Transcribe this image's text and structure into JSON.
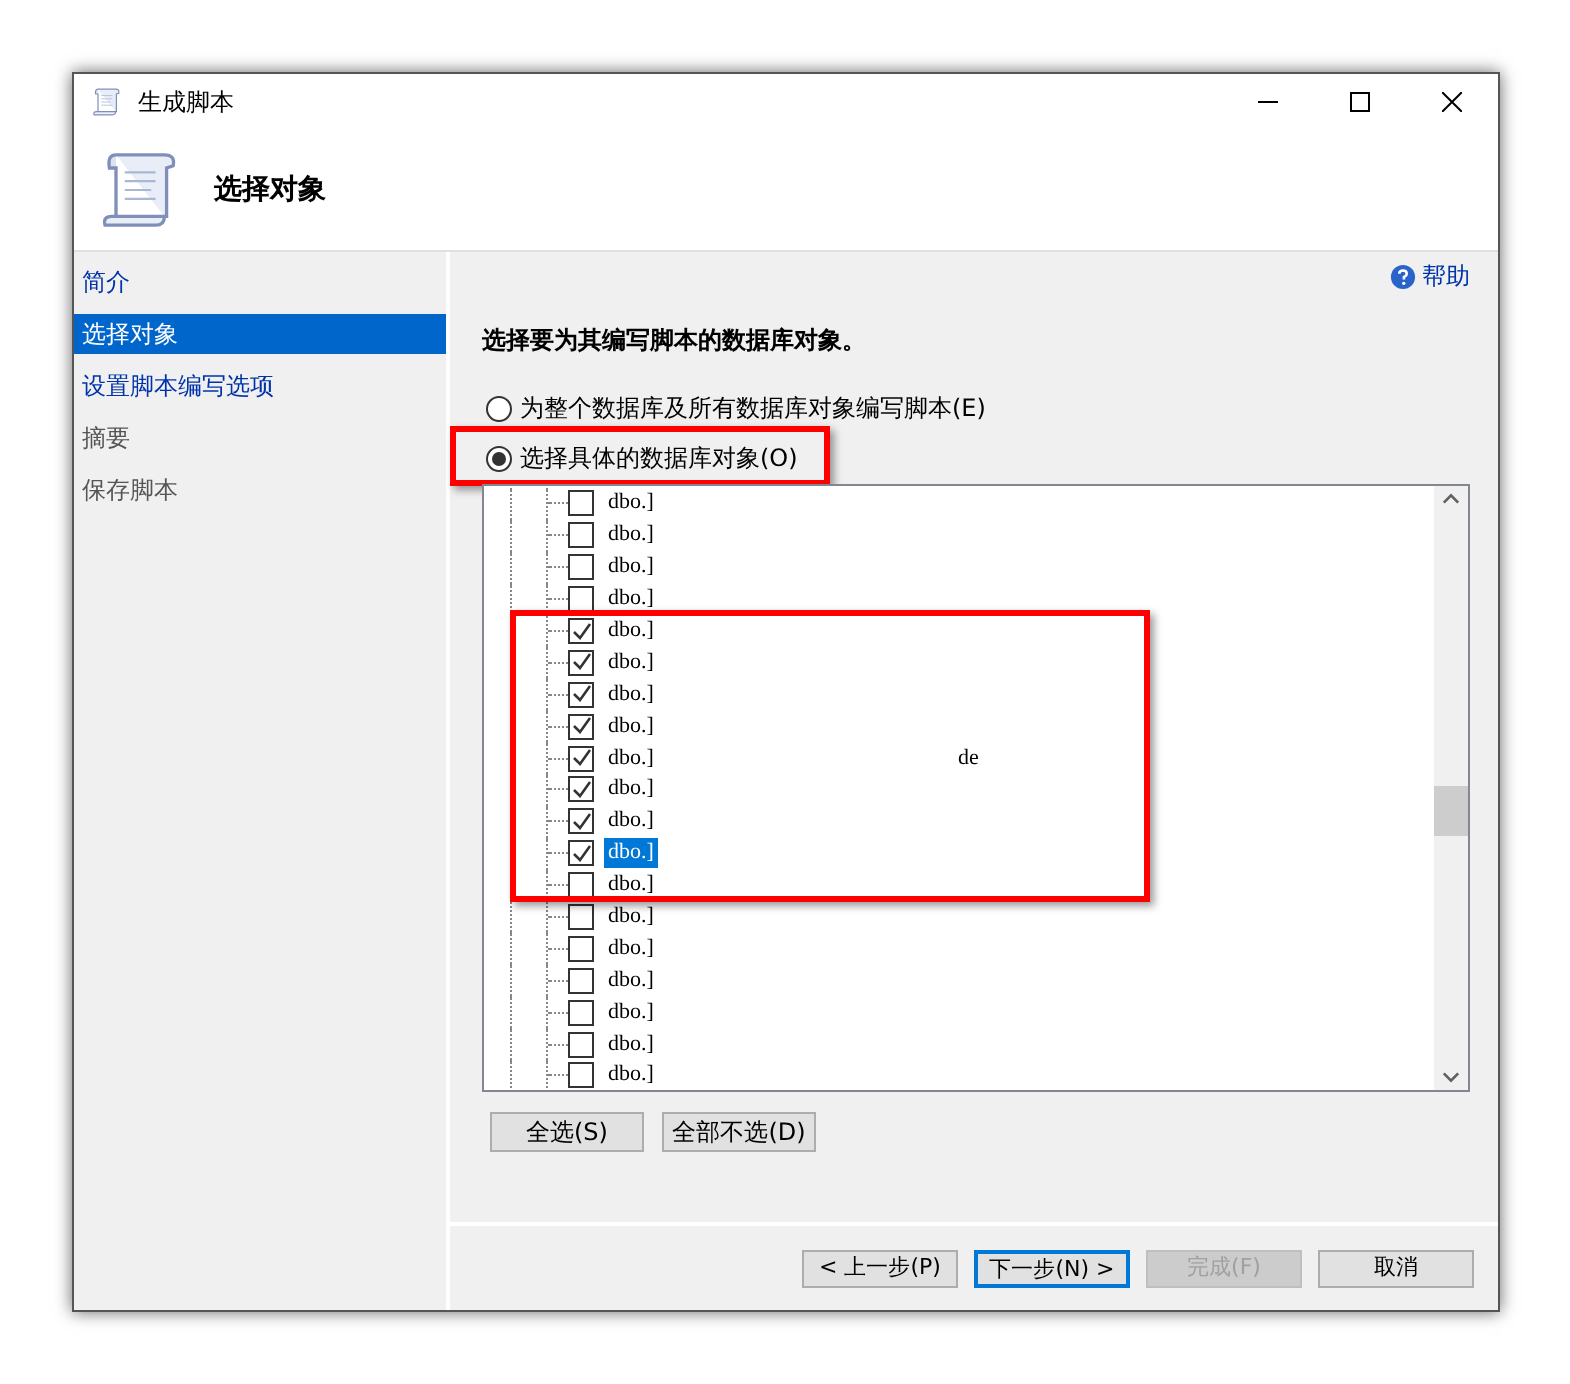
{
  "window": {
    "title": "生成脚本"
  },
  "header": {
    "title": "选择对象"
  },
  "sidebar": {
    "items": [
      {
        "label": "简介",
        "selected": false,
        "enabled": true
      },
      {
        "label": "选择对象",
        "selected": true,
        "enabled": true
      },
      {
        "label": "设置脚本编写选项",
        "selected": false,
        "enabled": true
      },
      {
        "label": "摘要",
        "selected": false,
        "enabled": false
      },
      {
        "label": "保存脚本",
        "selected": false,
        "enabled": false
      }
    ]
  },
  "help_link": "帮助",
  "heading": "选择要为其编写脚本的数据库对象。",
  "options": [
    {
      "label": "为整个数据库及所有数据库对象编写脚本(E)",
      "selected": false,
      "highlighted": false
    },
    {
      "label": "选择具体的数据库对象(O)",
      "selected": true,
      "highlighted": true
    }
  ],
  "tree": {
    "items": [
      {
        "label": "dbo.]",
        "checked": false,
        "selected": false
      },
      {
        "label": "dbo.]",
        "checked": false,
        "selected": false
      },
      {
        "label": "dbo.]",
        "checked": false,
        "selected": false
      },
      {
        "label": "dbo.]",
        "checked": false,
        "selected": false
      },
      {
        "label": "dbo.]",
        "checked": true,
        "selected": false
      },
      {
        "label": "dbo.]",
        "checked": true,
        "selected": false
      },
      {
        "label": "dbo.]",
        "checked": true,
        "selected": false
      },
      {
        "label": "dbo.]",
        "checked": true,
        "selected": false
      },
      {
        "label": "dbo.]",
        "checked": true,
        "selected": false,
        "column_2": "de"
      },
      {
        "label": "dbo.]",
        "checked": true,
        "selected": false
      },
      {
        "label": "dbo.]",
        "checked": true,
        "selected": false
      },
      {
        "label": "dbo.]",
        "checked": true,
        "selected": true
      },
      {
        "label": "dbo.]",
        "checked": false,
        "selected": false
      },
      {
        "label": "dbo.]",
        "checked": false,
        "selected": false
      },
      {
        "label": "dbo.]",
        "checked": false,
        "selected": false
      },
      {
        "label": "dbo.]",
        "checked": false,
        "selected": false
      },
      {
        "label": "dbo.]",
        "checked": false,
        "selected": false
      },
      {
        "label": "dbo.]",
        "checked": false,
        "selected": false
      },
      {
        "label": "dbo.]",
        "checked": false,
        "selected": false
      }
    ]
  },
  "tree_buttons": [
    "全选(S)",
    "全部不选(D)"
  ],
  "footer_buttons": [
    {
      "label": "< 上一步(P)",
      "disabled": false,
      "default": false
    },
    {
      "label": "下一步(N) >",
      "disabled": false,
      "default": true
    },
    {
      "label": "完成(F)",
      "disabled": true,
      "default": false
    },
    {
      "label": "取消",
      "disabled": false,
      "default": false
    }
  ]
}
